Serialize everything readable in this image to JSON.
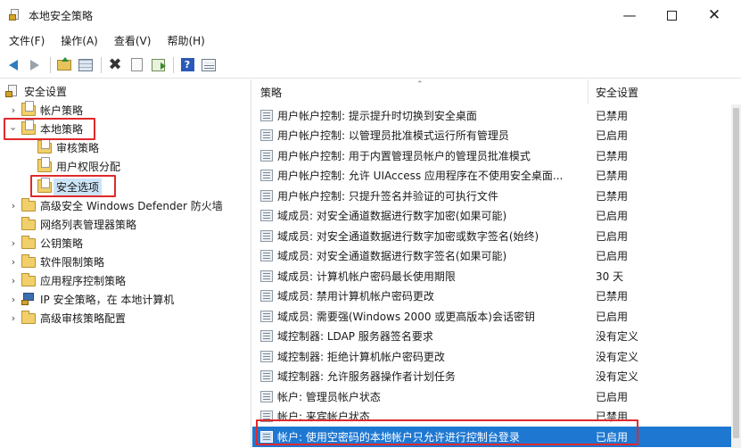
{
  "window": {
    "title": "本地安全策略"
  },
  "menu": [
    {
      "label": "文件(F)"
    },
    {
      "label": "操作(A)"
    },
    {
      "label": "查看(V)"
    },
    {
      "label": "帮助(H)"
    }
  ],
  "toolbar": {
    "icons": [
      "back-icon",
      "forward-icon",
      "up-folder-icon",
      "show-tree-icon",
      "delete-icon",
      "properties-icon",
      "export-icon",
      "help-icon",
      "list-view-icon"
    ]
  },
  "tree": {
    "root": "安全设置",
    "items": [
      {
        "label": "帐户策略"
      },
      {
        "label": "本地策略"
      },
      {
        "label": "审核策略"
      },
      {
        "label": "用户权限分配"
      },
      {
        "label": "安全选项"
      },
      {
        "label": "高级安全 Windows Defender 防火墙"
      },
      {
        "label": "网络列表管理器策略"
      },
      {
        "label": "公钥策略"
      },
      {
        "label": "软件限制策略"
      },
      {
        "label": "应用程序控制策略"
      },
      {
        "label": "IP 安全策略，在 本地计算机"
      },
      {
        "label": "高级审核策略配置"
      }
    ]
  },
  "list": {
    "columns": {
      "policy": "策略",
      "setting": "安全设置"
    },
    "rows": [
      {
        "policy": "用户帐户控制: 提示提升时切换到安全桌面",
        "setting": "已禁用"
      },
      {
        "policy": "用户帐户控制: 以管理员批准模式运行所有管理员",
        "setting": "已启用"
      },
      {
        "policy": "用户帐户控制: 用于内置管理员帐户的管理员批准模式",
        "setting": "已禁用"
      },
      {
        "policy": "用户帐户控制: 允许 UIAccess 应用程序在不使用安全桌面...",
        "setting": "已禁用"
      },
      {
        "policy": "用户帐户控制: 只提升签名并验证的可执行文件",
        "setting": "已禁用"
      },
      {
        "policy": "域成员: 对安全通道数据进行数字加密(如果可能)",
        "setting": "已启用"
      },
      {
        "policy": "域成员: 对安全通道数据进行数字加密或数字签名(始终)",
        "setting": "已启用"
      },
      {
        "policy": "域成员: 对安全通道数据进行数字签名(如果可能)",
        "setting": "已启用"
      },
      {
        "policy": "域成员: 计算机帐户密码最长使用期限",
        "setting": "30 天"
      },
      {
        "policy": "域成员: 禁用计算机帐户密码更改",
        "setting": "已禁用"
      },
      {
        "policy": "域成员: 需要强(Windows 2000 或更高版本)会话密钥",
        "setting": "已启用"
      },
      {
        "policy": "域控制器: LDAP 服务器签名要求",
        "setting": "没有定义"
      },
      {
        "policy": "域控制器: 拒绝计算机帐户密码更改",
        "setting": "没有定义"
      },
      {
        "policy": "域控制器: 允许服务器操作者计划任务",
        "setting": "没有定义"
      },
      {
        "policy": "帐户: 管理员帐户状态",
        "setting": "已启用"
      },
      {
        "policy": "帐户: 来宾帐户状态",
        "setting": "已禁用"
      },
      {
        "policy": "帐户: 使用空密码的本地帐户只允许进行控制台登录",
        "setting": "已启用"
      }
    ]
  }
}
